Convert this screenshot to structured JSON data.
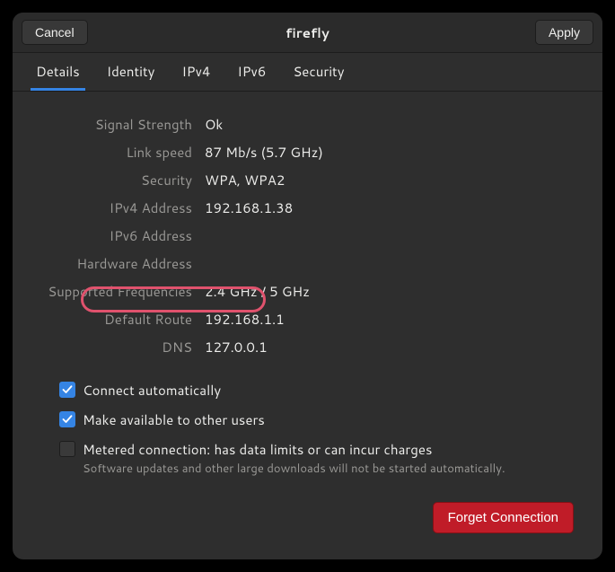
{
  "titlebar": {
    "cancel": "Cancel",
    "title": "firefly",
    "apply": "Apply"
  },
  "tabs": [
    {
      "label": "Details",
      "active": true
    },
    {
      "label": "Identity",
      "active": false
    },
    {
      "label": "IPv4",
      "active": false
    },
    {
      "label": "IPv6",
      "active": false
    },
    {
      "label": "Security",
      "active": false
    }
  ],
  "details": {
    "signal_strength": {
      "label": "Signal Strength",
      "value": "Ok"
    },
    "link_speed": {
      "label": "Link speed",
      "value": "87 Mb/s (5.7 GHz)"
    },
    "security": {
      "label": "Security",
      "value": "WPA, WPA2"
    },
    "ipv4": {
      "label": "IPv4 Address",
      "value": "192.168.1.38"
    },
    "ipv6": {
      "label": "IPv6 Address",
      "value": ""
    },
    "hw": {
      "label": "Hardware Address",
      "value": ""
    },
    "freq": {
      "label": "Supported Frequencies",
      "value": "2.4 GHz / 5 GHz"
    },
    "route": {
      "label": "Default Route",
      "value": "192.168.1.1"
    },
    "dns": {
      "label": "DNS",
      "value": "127.0.0.1"
    }
  },
  "checks": {
    "auto": {
      "label": "Connect automatically",
      "checked": true
    },
    "avail": {
      "label": "Make available to other users",
      "checked": true
    },
    "metered": {
      "label": "Metered connection: has data limits or can incur charges",
      "sublabel": "Software updates and other large downloads will not be started automatically.",
      "checked": false
    }
  },
  "footer": {
    "forget": "Forget Connection"
  },
  "highlight": {
    "target": "route"
  }
}
